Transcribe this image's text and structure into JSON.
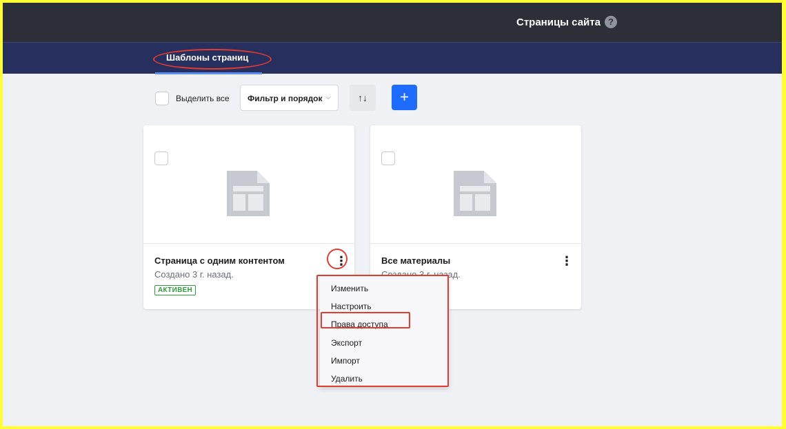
{
  "header": {
    "title": "Страницы сайта",
    "help_symbol": "?"
  },
  "tabs": [
    {
      "label": "Шаблоны страниц",
      "active": true
    }
  ],
  "toolbar": {
    "select_all_label": "Выделить все",
    "filter_label": "Фильтр и порядок",
    "filter_chevron": "⌵",
    "sort_symbol": "↑↓",
    "add_symbol": "+"
  },
  "cards": [
    {
      "title": "Страница с одним контентом",
      "subtitle": "Создано 3 г. назад.",
      "status": "АКТИВЕН",
      "kebab": "⋮"
    },
    {
      "title": "Все материалы",
      "subtitle": "Создано 3 г. назад.",
      "kebab": "⋮"
    }
  ],
  "context_menu": {
    "items": [
      "Изменить",
      "Настроить",
      "Права доступа",
      "Экспорт",
      "Импорт",
      "Удалить"
    ]
  },
  "colors": {
    "topbar": "#2d2f38",
    "tabbar": "#262f5e",
    "accent": "#1e6bff",
    "status_active": "#2e9b3e",
    "highlight": "#e23b2f",
    "outer_frame": "#ffff33"
  }
}
